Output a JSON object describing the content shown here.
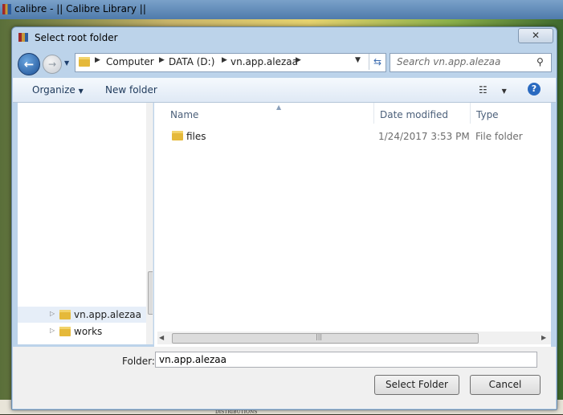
{
  "background_app": {
    "title": "calibre - || Calibre Library ||",
    "footer_text": "DISTRIBUTIONS"
  },
  "dialog": {
    "title": "Select root folder",
    "close_glyph": "✕"
  },
  "navigation": {
    "back_glyph": "←",
    "forward_glyph": "→",
    "breadcrumbs": [
      "Computer",
      "DATA (D:)",
      "vn.app.alezaa"
    ],
    "search_placeholder": "Search vn.app.alezaa"
  },
  "toolbar": {
    "organize_label": "Organize",
    "new_folder_label": "New folder",
    "help_glyph": "?"
  },
  "nav_tree": {
    "items": [
      {
        "label": "vn.app.alezaa",
        "selected": true
      },
      {
        "label": "works",
        "selected": false
      }
    ]
  },
  "file_list": {
    "columns": [
      "Name",
      "Date modified",
      "Type"
    ],
    "rows": [
      {
        "name": "files",
        "date": "1/24/2017 3:53 PM",
        "type": "File folder"
      }
    ]
  },
  "footer": {
    "folder_label": "Folder:",
    "folder_value": "vn.app.alezaa",
    "select_button": "Select Folder",
    "cancel_button": "Cancel"
  },
  "colors": {
    "accent": "#2a6ac0",
    "folder": "#e5b93a"
  }
}
